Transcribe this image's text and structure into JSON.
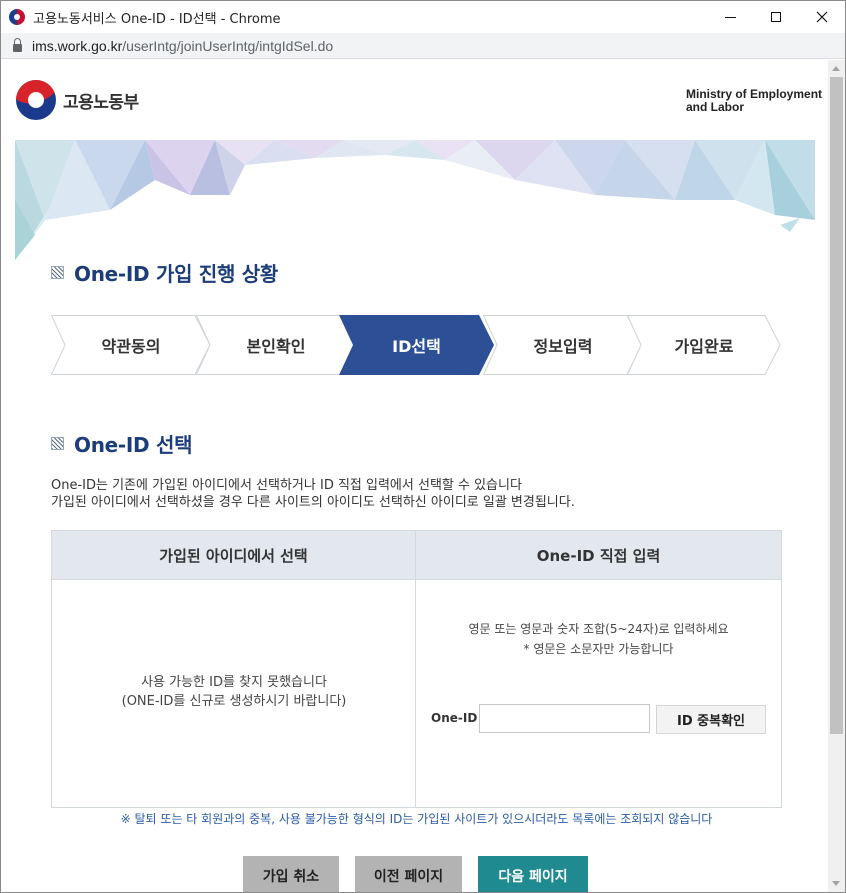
{
  "window": {
    "title": "고용노동서비스 One-ID - ID선택 - Chrome",
    "url_host": "ims.work.go.kr",
    "url_path": "/userIntg/joinUserIntg/intgIdSel.do"
  },
  "header": {
    "logo_text": "고용노동부",
    "ministry_line1": "Ministry of Employment",
    "ministry_line2": "and Labor"
  },
  "progress": {
    "title": "One-ID 가입 진행 상황",
    "steps": [
      {
        "label": "약관동의",
        "active": false
      },
      {
        "label": "본인확인",
        "active": false
      },
      {
        "label": "ID선택",
        "active": true
      },
      {
        "label": "정보입력",
        "active": false
      },
      {
        "label": "가입완료",
        "active": false
      }
    ]
  },
  "select": {
    "title": "One-ID 선택",
    "desc_line1": "One-ID는 기존에 가입된 아이디에서 선택하거나 ID 직접 입력에서 선택할 수 있습니다",
    "desc_line2": "가입된 아이디에서 선택하셨을 경우 다른 사이트의 아이디도 선택하신 아이디로 일괄 변경됩니다.",
    "left_header": "가입된 아이디에서 선택",
    "right_header": "One-ID 직접 입력",
    "notfound_line1": "사용 가능한 ID를 찾지 못했습니다",
    "notfound_line2": "(ONE-ID를 신규로 생성하시기 바랍니다)",
    "rule_line1": "영문 또는 영문과 숫자 조합(5~24자)로 입력하세요",
    "rule_line2": "* 영문은 소문자만 가능합니다",
    "id_label": "One-ID",
    "id_value": "",
    "dup_button": "ID 중복확인",
    "notice": "※ 탈퇴 또는 타 회원과의 중복, 사용 불가능한 형식의 ID는 가입된 사이트가 있으시더라도 목록에는 조회되지 않습니다"
  },
  "buttons": {
    "cancel": "가입 취소",
    "prev": "이전 페이지",
    "next": "다음 페이지"
  },
  "colors": {
    "primary": "#1c3d7a",
    "step_active": "#2c4f96",
    "next_button": "#1f8a8f",
    "notice": "#2a5ba8"
  }
}
